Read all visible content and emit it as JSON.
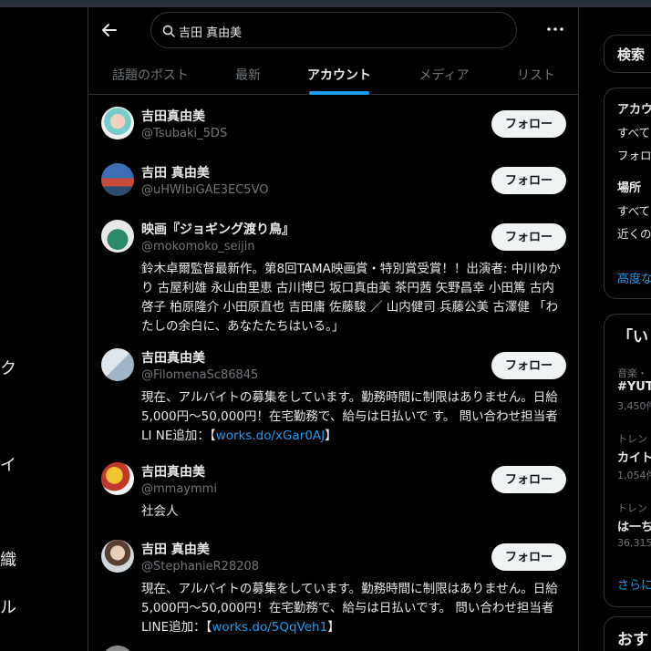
{
  "search": {
    "query": "吉田 真由美"
  },
  "tabs": [
    {
      "label": "話題のポスト",
      "active": false
    },
    {
      "label": "最新",
      "active": false
    },
    {
      "label": "アカウント",
      "active": true
    },
    {
      "label": "メディア",
      "active": false
    },
    {
      "label": "リスト",
      "active": false
    }
  ],
  "follow_label": "フォロー",
  "users": [
    {
      "name": "吉田真由美",
      "handle": "@Tsubaki_5DS",
      "bio": ""
    },
    {
      "name": "吉田 真由美",
      "handle": "@uHWIbiGAE3EC5VO",
      "bio": ""
    },
    {
      "name": "映画『ジョギング渡り鳥』",
      "handle": "@mokomoko_seijin",
      "bio": "鈴木卓爾監督最新作。第8回TAMA映画賞・特別賞受賞！！出演者: 中川ゆかり 古屋利雄 永山由里恵 古川博巳 坂口真由美 茶円茜 矢野昌幸 小田篤 古内啓子 柏原隆介 小田原直也 吉田庸 佐藤駿 ／ 山内健司 兵藤公美 古澤健 「わたしの余白に、あなたたちはいる。」"
    },
    {
      "name": "吉田真由美",
      "handle": "@FilomenaSc86845",
      "bio_pre": "現在、アルバイトの募集をしています。勤務時間に制限はありません。日給5,000円～50,000円！在宅勤務で、給与は日払いで す。 問い合わせ担当者LI NE追加：【",
      "bio_link": "works.do/xGar0AJ",
      "bio_post": "】"
    },
    {
      "name": "吉田真由美",
      "handle": "@mmaymmi",
      "bio": "社会人"
    },
    {
      "name": "吉田 真由美",
      "handle": "@StephanieR28208",
      "bio_pre": "現在、アルバイトの募集をしています。勤務時間に制限はありません。日給5,000円～50,000円！在宅勤務で、給与は日払いです。 問い合わせ担当者LINE追加：【",
      "bio_link": "works.do/5QqVeh1",
      "bio_post": "】"
    }
  ],
  "left_nav_fragments": [
    "ク",
    "イ",
    "織",
    "ル"
  ],
  "right_column": {
    "search_heading": "検索",
    "account_heading": "アカウ",
    "account_opt1": "すべて",
    "account_opt2": "フォロ",
    "location_heading": "場所",
    "location_opt1": "すべて",
    "location_opt2": "近くの",
    "advanced_link": "高度な",
    "trends_heading": "「い",
    "trend1_category": "音楽・",
    "trend1_name": "#YUT",
    "trend1_count": "3,450件",
    "trend2_category": "トレン",
    "trend2_name": "カイト",
    "trend2_count": "1,054件",
    "trend3_category": "トレン",
    "trend3_name": "は一ち",
    "trend3_count": "36,315",
    "show_more_link": "さらに",
    "recommend_heading": "おす"
  },
  "colors": {
    "accent": "#1d9bf0",
    "background": "#000000",
    "border": "#2f3336",
    "muted": "#71767b"
  }
}
